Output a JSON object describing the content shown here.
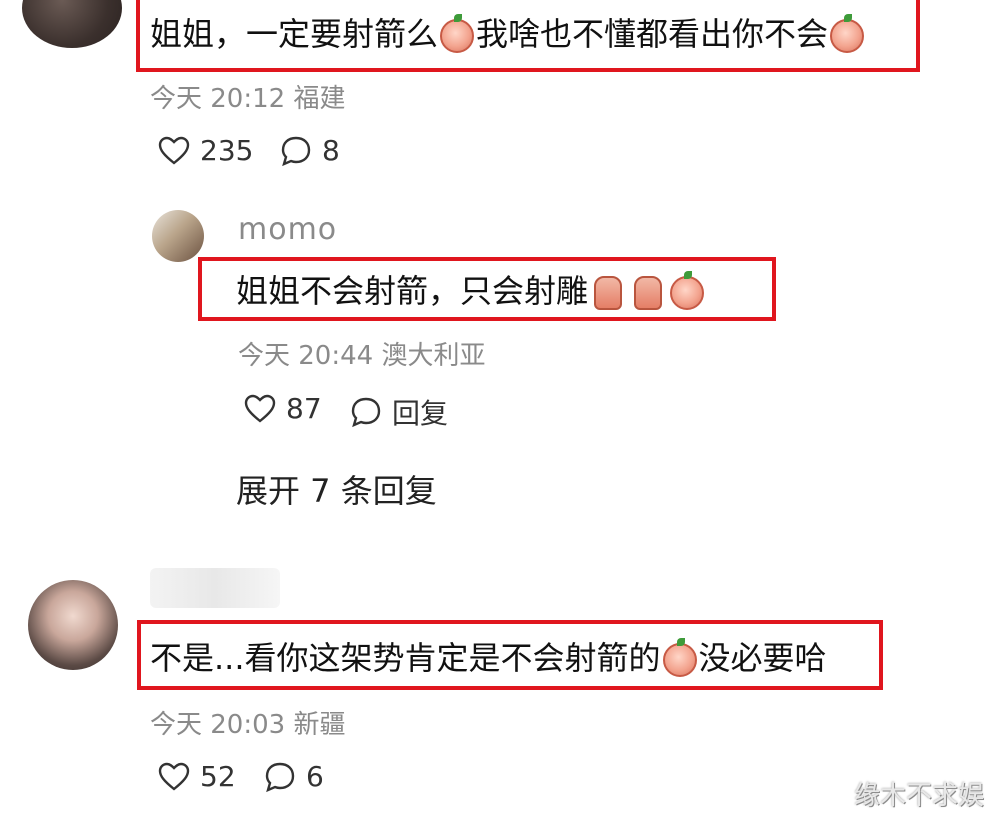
{
  "comments": [
    {
      "text_parts": [
        "姐姐，一定要射箭么",
        "我啥也不懂都看出你不会"
      ],
      "meta": "今天 20:12 福建",
      "likes": "235",
      "replies": "8"
    },
    {
      "username": "momo",
      "text": "姐姐不会射箭，只会射雕",
      "meta": "今天 20:44 澳大利亚",
      "likes": "87",
      "reply_label": "回复"
    },
    {
      "expand_label": "展开 7 条回复"
    },
    {
      "text_parts": [
        "不是...看你这架势肯定是不会射箭的",
        "没必要哈"
      ],
      "meta": "今天 20:03 新疆",
      "likes": "52",
      "replies": "6"
    }
  ],
  "watermark": "缘木不求娱",
  "icons": {
    "like": "heart-outline-icon",
    "comment": "speech-bubble-icon",
    "emoji_laugh": "laughing-peach-emoji",
    "emoji_cry": "crying-laughing-emoji",
    "emoji_victory": "victory-hand-emoji"
  },
  "colors": {
    "highlight_border": "#e0161e",
    "meta_text": "#8a8a8a"
  }
}
